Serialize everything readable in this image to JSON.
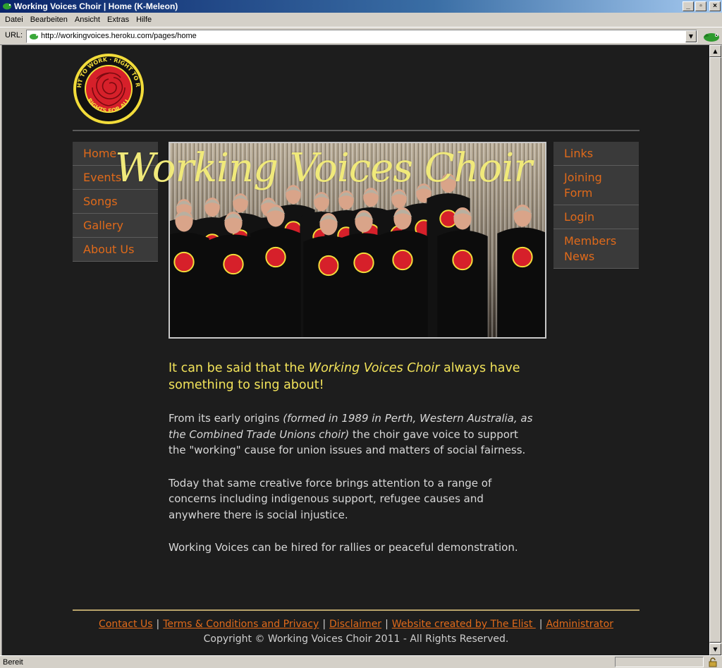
{
  "window": {
    "title": "Working Voices Choir | Home (K-Meleon)",
    "buttons": [
      "_",
      "▫",
      "×"
    ]
  },
  "menubar": [
    "Datei",
    "Bearbeiten",
    "Ansicht",
    "Extras",
    "Hilfe"
  ],
  "urlbar": {
    "label": "URL:",
    "value": "http://workingvoices.heroku.com/pages/home"
  },
  "status": {
    "text": "Bereit"
  },
  "logo": {
    "ring_text_top": "RIGHT TO WORK · RIGHT TO REST",
    "ring_text_bottom": "RIGHTS FOR ALL"
  },
  "nav_left": [
    "Home",
    "Events",
    "Songs",
    "Gallery",
    "About Us"
  ],
  "nav_right": [
    {
      "line1": "Links",
      "line2": ""
    },
    {
      "line1": "Joining",
      "line2": "Form"
    },
    {
      "line1": "Login",
      "line2": ""
    },
    {
      "line1": "Members",
      "line2": "News"
    }
  ],
  "hero": {
    "title": "Working Voices Choir"
  },
  "content": {
    "lead_before": "It can be said that the ",
    "lead_em": "Working Voices Choir",
    "lead_after": " always have something to sing about!",
    "p1_before": "From its early origins ",
    "p1_em": "(formed in 1989 in Perth, Western Australia, as the Combined Trade Unions choir)",
    "p1_after": " the choir gave voice to support the \"working\" cause for union issues and matters of social fairness.",
    "p2": "Today that same creative force brings attention to a range of concerns including indigenous support, refugee causes and anywhere there is social injustice.",
    "p3": "Working Voices can be hired for rallies or peaceful demonstration."
  },
  "footer": {
    "links": [
      "Contact Us",
      "Terms & Conditions and Privacy",
      "Disclaimer",
      "Website created by The Elist ",
      "Administrator"
    ],
    "separator": "|",
    "copyright": "Copyright © Working Voices Choir 2011 - All Rights Reserved."
  },
  "colors": {
    "background": "#1d1d1d",
    "nav_bg": "#3a3a3a",
    "link": "#e06a1a",
    "lead": "#f2e35a",
    "hero_title": "#f0e97a",
    "rule": "#b8a36a"
  }
}
